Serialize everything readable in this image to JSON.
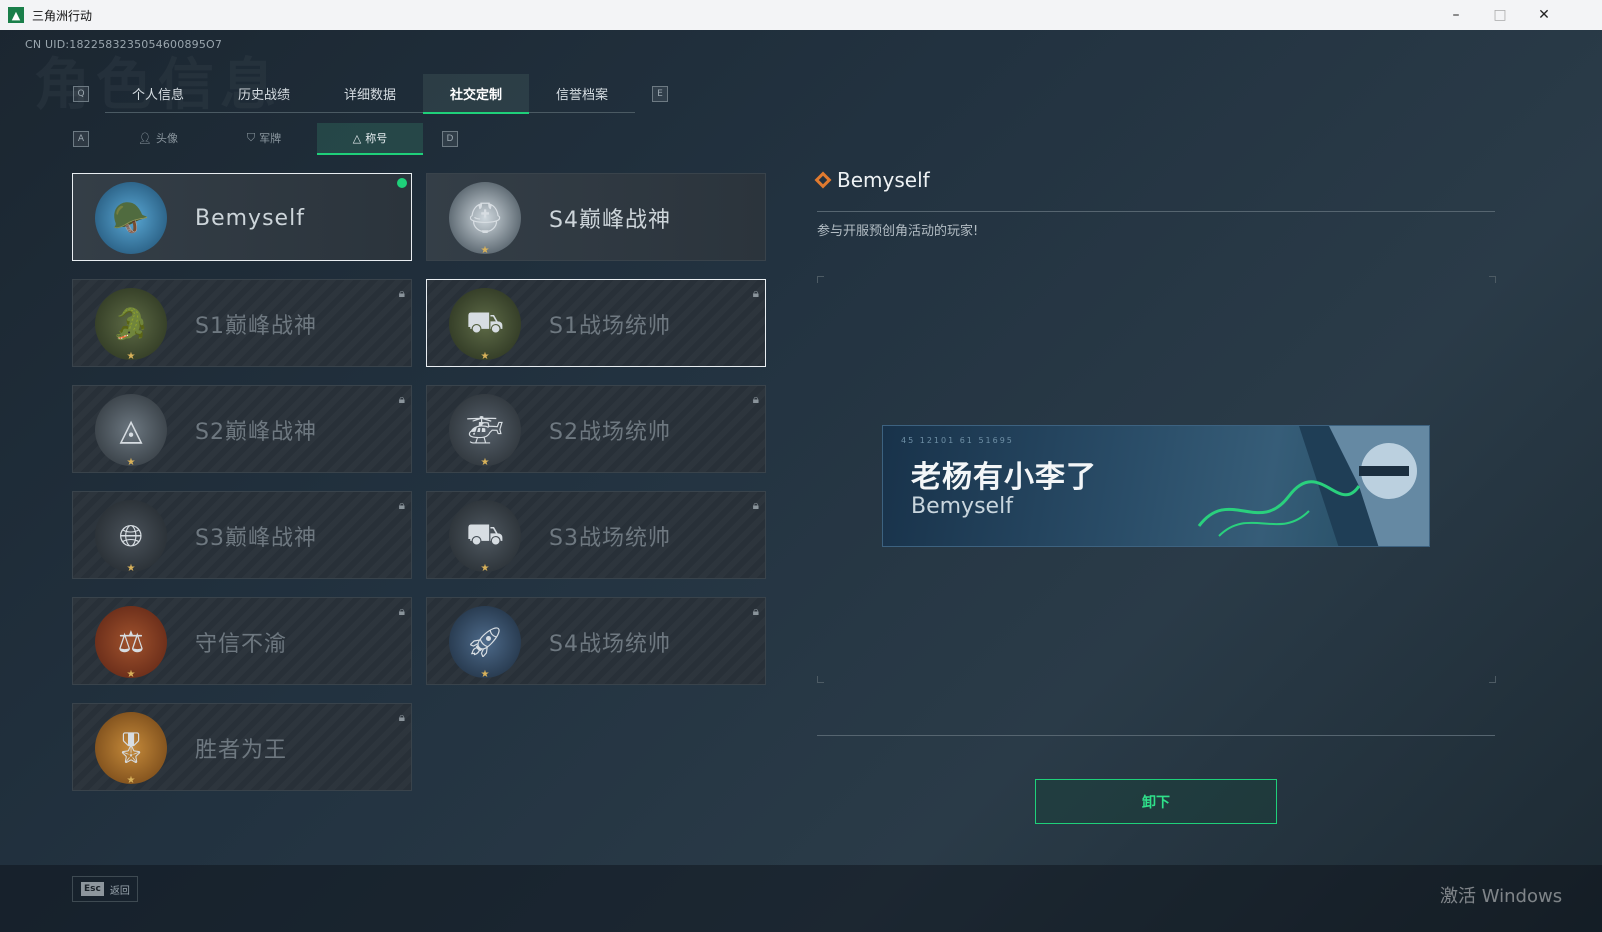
{
  "window": {
    "title": "三角洲行动",
    "minimize": "–",
    "maximize": "□",
    "close": "✕"
  },
  "uid": "CN UID:1822583235054600895O7",
  "watermark_title": "角色信息",
  "key_hints": {
    "prev_tab": "Q",
    "next_tab": "E",
    "prev_sub": "A",
    "next_sub": "D"
  },
  "tabs": [
    {
      "label": "个人信息"
    },
    {
      "label": "历史战绩"
    },
    {
      "label": "详细数据"
    },
    {
      "label": "社交定制",
      "active": true
    },
    {
      "label": "信誉档案"
    }
  ],
  "subtabs": [
    {
      "label": "头像",
      "icon": "person-icon"
    },
    {
      "label": "军牌",
      "icon": "tag-icon"
    },
    {
      "label": "称号",
      "icon": "triangle-icon",
      "active": true
    }
  ],
  "titles": [
    {
      "name": "Bemyself",
      "owned": true,
      "equipped": true
    },
    {
      "name": "S4巅峰战神",
      "owned": true
    },
    {
      "name": "S1巅峰战神",
      "locked": true
    },
    {
      "name": "S1战场统帅",
      "locked": true,
      "focused": true
    },
    {
      "name": "S2巅峰战神",
      "locked": true
    },
    {
      "name": "S2战场统帅",
      "locked": true
    },
    {
      "name": "S3巅峰战神",
      "locked": true
    },
    {
      "name": "S3战场统帅",
      "locked": true
    },
    {
      "name": "守信不渝",
      "locked": true
    },
    {
      "name": "S4战场统帅",
      "locked": true
    },
    {
      "name": "胜者为王",
      "locked": true
    }
  ],
  "detail": {
    "title": "Bemyself",
    "description": "参与开服预创角活动的玩家!",
    "banner_codes": "45 12101  61 51695",
    "banner_player_name": "老杨有小李了",
    "banner_title": "Bemyself",
    "unequip_button": "卸下"
  },
  "bottom": {
    "esc_key": "Esc",
    "esc_label": "返回"
  },
  "os_watermark": "激活 Windows",
  "colors": {
    "accent": "#1fd07a",
    "title_icon": "#e07a2f"
  }
}
